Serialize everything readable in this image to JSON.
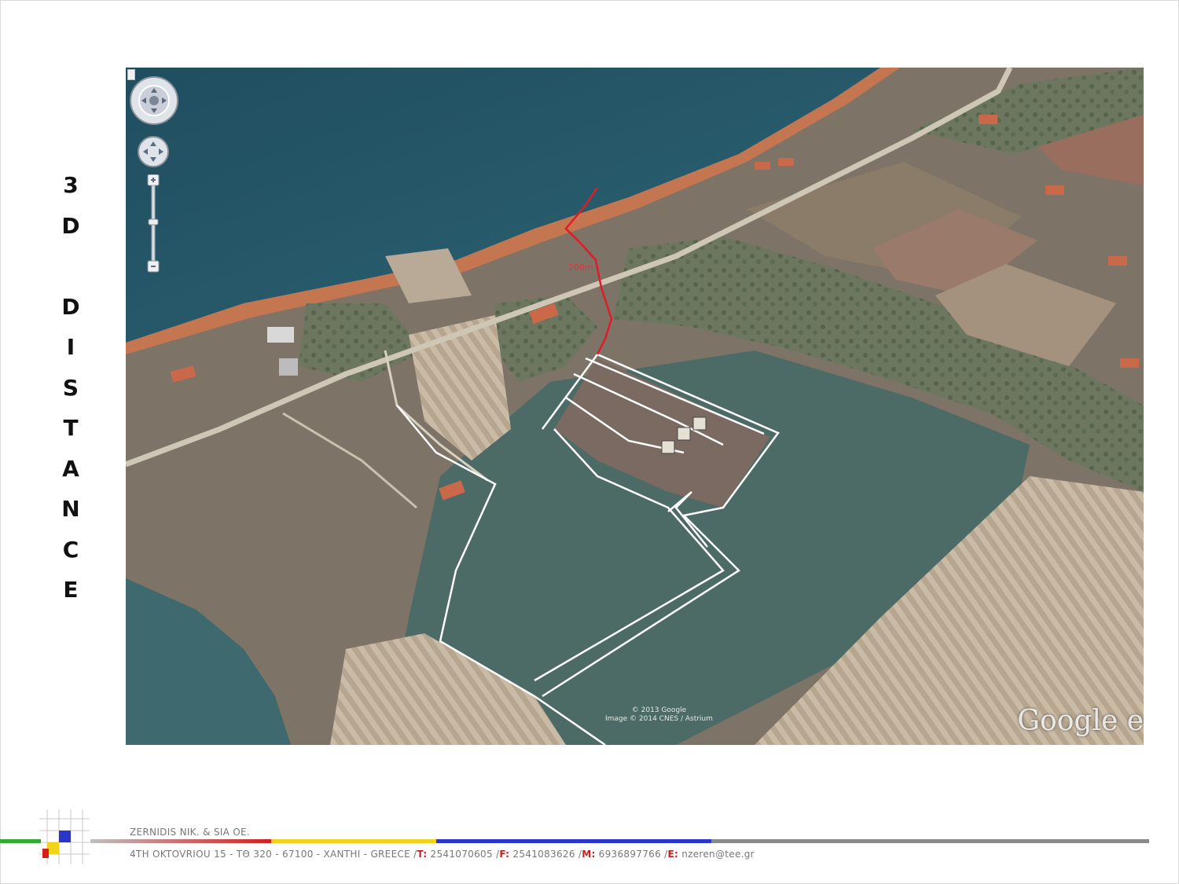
{
  "side_title_letters": [
    "3",
    "D",
    "",
    "D",
    "I",
    "S",
    "T",
    "A",
    "N",
    "C",
    "E"
  ],
  "map": {
    "distance_label": "200m",
    "watermark_line1": "",
    "watermark_line2": "",
    "copyright_line1": "© 2013 Google",
    "copyright_line2": "Image © 2014 CNES / Astrium",
    "google_logo": "Google e"
  },
  "footer": {
    "company": "ZERNIDIS NIK. & SIA OE.",
    "address_prefix": "4TH OKTOVRIOU 15 - ΤΘ 320 - 67100 - XANTHI - GREECE /",
    "t_key": "T:",
    "t_val": " 2541070605 /",
    "f_key": "F:",
    "f_val": " 2541083626 /",
    "m_key": "M:",
    "m_val": " 6936897766 /",
    "e_key": "E:",
    "e_val": " nzeren@tee.gr"
  },
  "colors": {
    "stripe": [
      "#33aa33",
      "#d21f1f",
      "#f2d21b",
      "#2a35c9",
      "#8a8a8a"
    ]
  },
  "icons": {
    "navigation": "look-around-icon",
    "move": "move-pan-icon",
    "zoom": "zoom-slider-icon"
  }
}
